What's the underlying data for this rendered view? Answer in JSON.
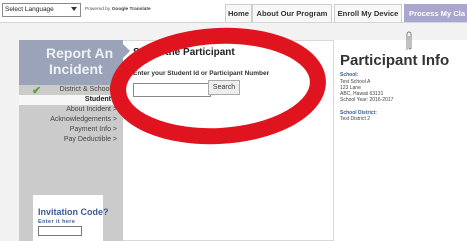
{
  "toolbar": {
    "language_select": "Select Language",
    "powered_by": "Powered by",
    "google_translate": "Google Translate"
  },
  "nav": {
    "home": "Home",
    "about": "About Our Program",
    "enroll": "Enroll My Device",
    "process": "Process My Cla"
  },
  "sidebar": {
    "header_line1": "Report An",
    "header_line2": "Incident",
    "steps": [
      "District & School >",
      "Student >",
      "About Incident >",
      "Acknowledgements >",
      "Payment Info >",
      "Pay Deductible >"
    ],
    "invitation_title": "Invitation Code?",
    "invitation_sub": "Enter it here"
  },
  "main": {
    "title": "Select the Participant",
    "label": "Enter your Student Id or Participant Number",
    "input_value": "",
    "search_label": "Search"
  },
  "info": {
    "title": "Participant Info",
    "school_label": "School:",
    "school_lines": [
      "Test School A",
      "123 Lane",
      "ABC, Hawaii 63131",
      "School Year: 2016-2017"
    ],
    "district_label": "School District:",
    "district_value": "Test District 2"
  },
  "colors": {
    "accent": "#9aa3b7",
    "nav_active": "#a9a7cf",
    "annotation_red": "#e0141e",
    "check_green": "#5fa52c"
  }
}
